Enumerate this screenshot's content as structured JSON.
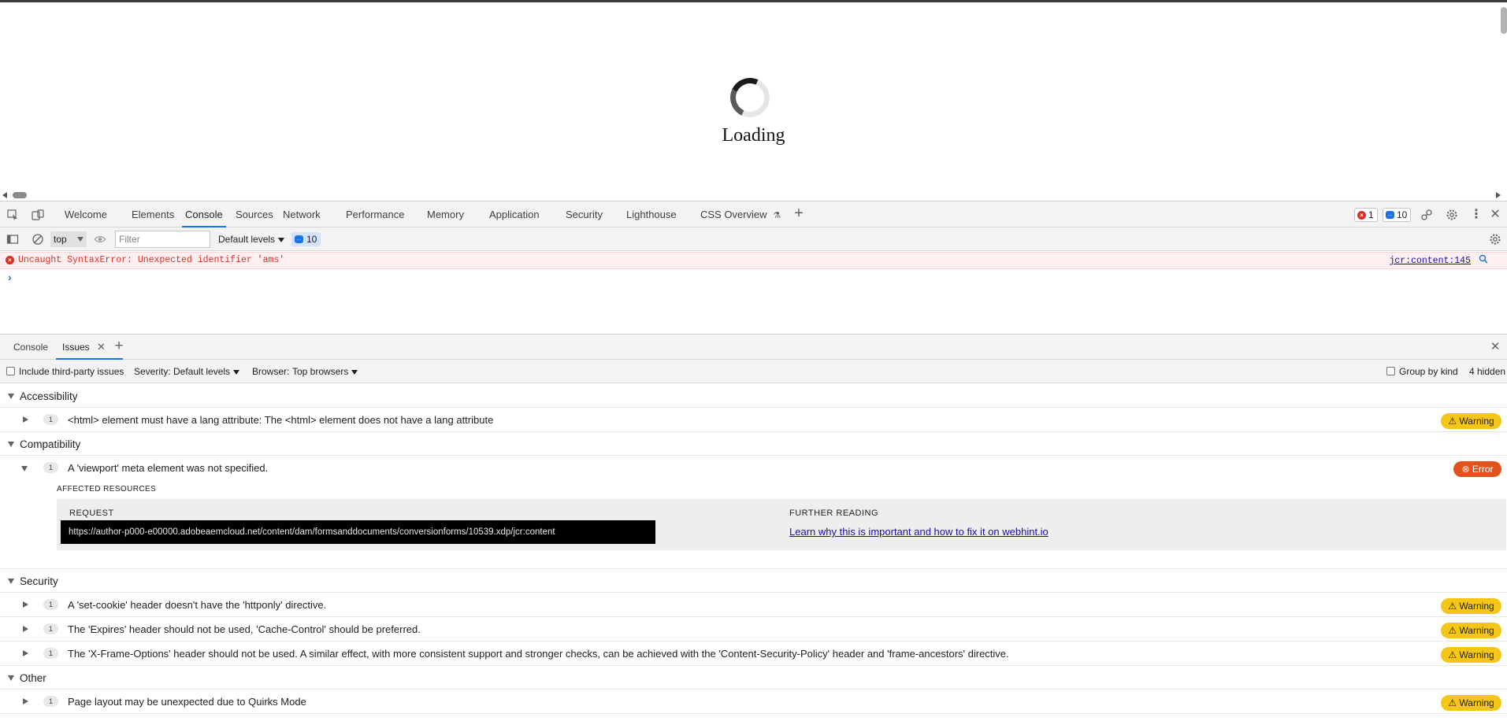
{
  "page": {
    "loading_text": "Loading"
  },
  "devtools": {
    "tabs": [
      {
        "label": "Welcome"
      },
      {
        "label": "Elements"
      },
      {
        "label": "Console"
      },
      {
        "label": "Sources"
      },
      {
        "label": "Network"
      },
      {
        "label": "Performance"
      },
      {
        "label": "Memory"
      },
      {
        "label": "Application"
      },
      {
        "label": "Security"
      },
      {
        "label": "Lighthouse"
      },
      {
        "label": "CSS Overview"
      }
    ],
    "active_tab": "Console",
    "error_count": "1",
    "message_count": "10"
  },
  "console_toolbar": {
    "context": "top",
    "filter_placeholder": "Filter",
    "levels": "Default levels",
    "message_count": "10"
  },
  "console": {
    "error_message": "Uncaught SyntaxError: Unexpected identifier 'ams'",
    "error_source": "jcr:content:145",
    "prompt": "›"
  },
  "drawer": {
    "tabs": [
      {
        "label": "Console"
      },
      {
        "label": "Issues"
      }
    ],
    "active_tab": "Issues"
  },
  "issues_toolbar": {
    "third_party": "Include third-party issues",
    "severity_label": "Severity:",
    "severity_value": "Default levels",
    "browser_label": "Browser:",
    "browser_value": "Top browsers",
    "group_by_kind": "Group by kind",
    "hidden": "4 hidden"
  },
  "issues": {
    "accessibility": {
      "name": "Accessibility",
      "items": [
        {
          "count": "1",
          "text": "<html> element must have a lang attribute: The <html> element does not have a lang attribute",
          "severity": "Warning"
        }
      ]
    },
    "compatibility": {
      "name": "Compatibility",
      "items": [
        {
          "count": "1",
          "text": "A 'viewport' meta element was not specified.",
          "severity": "Error"
        }
      ],
      "affected_title": "AFFECTED RESOURCES",
      "request_label": "REQUEST",
      "request_url": "https://author-p000-e00000.adobeaemcloud.net/content/dam/formsanddocuments/conversionforms/10539.xdp/jcr:content",
      "further_reading_label": "FURTHER READING",
      "further_reading_link": "Learn why this is important and how to fix it on webhint.io"
    },
    "security": {
      "name": "Security",
      "items": [
        {
          "count": "1",
          "text": "A 'set-cookie' header doesn't have the 'httponly' directive.",
          "severity": "Warning"
        },
        {
          "count": "1",
          "text": "The 'Expires' header should not be used, 'Cache-Control' should be preferred.",
          "severity": "Warning"
        },
        {
          "count": "1",
          "text": "The 'X-Frame-Options' header should not be used. A similar effect, with more consistent support and stronger checks, can be achieved with the 'Content-Security-Policy' header and 'frame-ancestors' directive.",
          "severity": "Warning"
        }
      ]
    },
    "other": {
      "name": "Other",
      "items": [
        {
          "count": "1",
          "text": "Page layout may be unexpected due to Quirks Mode",
          "severity": "Warning"
        }
      ]
    }
  },
  "colors": {
    "accent": "#1a73e8",
    "warning": "#f5c518",
    "error": "#e2521d"
  }
}
